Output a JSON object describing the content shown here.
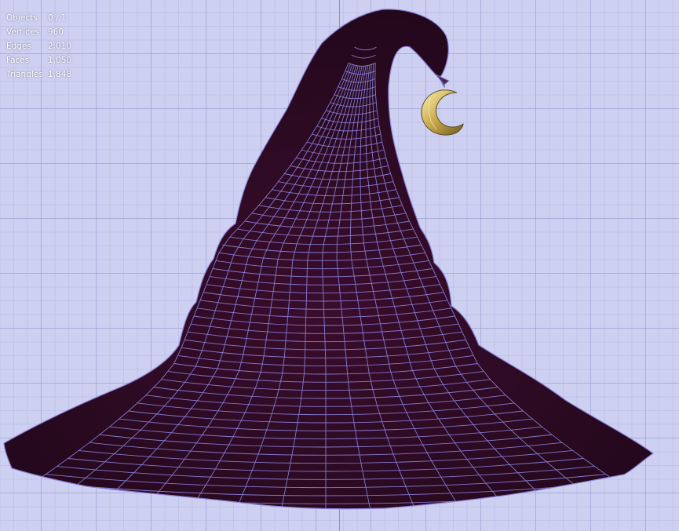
{
  "stats": {
    "objects_label": "Objects",
    "objects_value": "0 / 1",
    "vertices_label": "Vertices",
    "vertices_value": "960",
    "edges_label": "Edges",
    "edges_value": "2,010",
    "faces_label": "Faces",
    "faces_value": "1,050",
    "triangles_label": "Triangles",
    "triangles_value": "1,848"
  },
  "colors": {
    "background": "#cdd0f0",
    "grid": "#969ccd",
    "hat_fill": "#2a0a22",
    "wireframe": "#8a7fd8",
    "moon": "#c8b46a"
  }
}
